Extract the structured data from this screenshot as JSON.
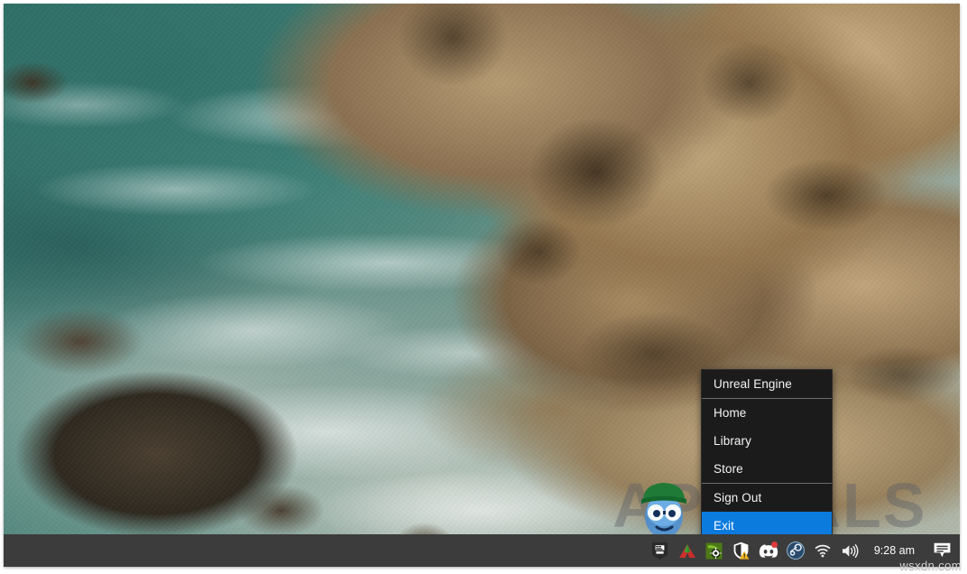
{
  "desktop": {
    "wallpaper_description": "Aerial photo of rocky coastline with teal ocean water, white surf foam and sea lions on tan rocks",
    "wallpaper_colors": {
      "water_teal": "#3c7d74",
      "foam_white": "#e8eeea",
      "rock_tan": "#c2a87e",
      "rock_shadow": "#2b1d0e",
      "kelp_dark": "#2e281f"
    }
  },
  "context_menu": {
    "name": "Epic Games Launcher tray menu",
    "background": "#1b1b1b",
    "highlight_color": "#0b7bde",
    "groups": [
      {
        "items": [
          {
            "label": "Unreal Engine",
            "selected": false
          }
        ]
      },
      {
        "items": [
          {
            "label": "Home",
            "selected": false
          },
          {
            "label": "Library",
            "selected": false
          },
          {
            "label": "Store",
            "selected": false
          }
        ]
      },
      {
        "items": [
          {
            "label": "Sign Out",
            "selected": false
          },
          {
            "label": "Exit",
            "selected": true
          }
        ]
      }
    ]
  },
  "taskbar": {
    "background": "#3c3c3c",
    "tray_icons": [
      {
        "name": "epic-games-icon",
        "title": "Epic Games Launcher",
        "badge": false
      },
      {
        "name": "amd-radeon-icon",
        "title": "AMD Radeon Software",
        "badge": false
      },
      {
        "name": "nvidia-icon",
        "title": "NVIDIA Settings",
        "badge": false
      },
      {
        "name": "windows-security-shield-icon",
        "title": "Windows Security",
        "badge": true
      },
      {
        "name": "discord-icon",
        "title": "Discord",
        "badge": true
      },
      {
        "name": "steam-icon",
        "title": "Steam",
        "badge": false
      },
      {
        "name": "wifi-icon",
        "title": "Network",
        "badge": false
      },
      {
        "name": "volume-icon",
        "title": "Speakers",
        "badge": false
      }
    ],
    "clock": "9:28 am",
    "action_center": {
      "name": "action-center-icon",
      "title": "Notifications"
    }
  },
  "watermarks": {
    "primary": "APPUALS",
    "secondary": "wsxdn.com"
  }
}
